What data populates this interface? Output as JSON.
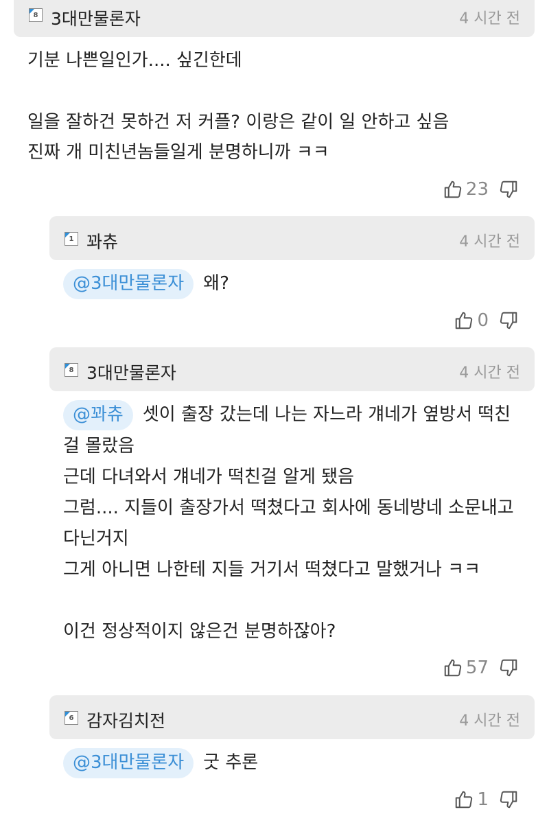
{
  "comments": [
    {
      "badge": "8",
      "username": "3대만물론자",
      "time": "4 시간 전",
      "lines": [
        "기분 나쁜일인가.... 싶긴한데",
        "",
        "일을 잘하건 못하건 저 커플? 이랑은 같이 일 안하고 싶음",
        "진짜 개 미친년놈들일게 분명하니까 ㅋㅋ"
      ],
      "likes": "23"
    },
    {
      "badge": "1",
      "username": "꽈츄",
      "time": "4 시간 전",
      "mention": "@3대만물론자",
      "lines": [
        "왜?"
      ],
      "likes": "0"
    },
    {
      "badge": "8",
      "username": "3대만물론자",
      "time": "4 시간 전",
      "mention": "@꽈츄",
      "first_line": "셋이 출장 갔는데 나는 자느라 걔네가 옆방서 떡친",
      "lines": [
        "걸 몰랐음",
        "근데 다녀와서 걔네가 떡친걸 알게 됐음",
        "그럼.... 지들이 출장가서 떡쳤다고 회사에 동네방네 소문내고",
        "다닌거지",
        "그게 아니면 나한테 지들 거기서 떡쳤다고 말했거나 ㅋㅋ",
        "",
        "이건 정상적이지 않은건 분명하잖아?"
      ],
      "likes": "57"
    },
    {
      "badge": "6",
      "username": "감자김치전",
      "time": "4 시간 전",
      "mention": "@3대만물론자",
      "lines": [
        "굿 추론"
      ],
      "likes": "1"
    }
  ]
}
